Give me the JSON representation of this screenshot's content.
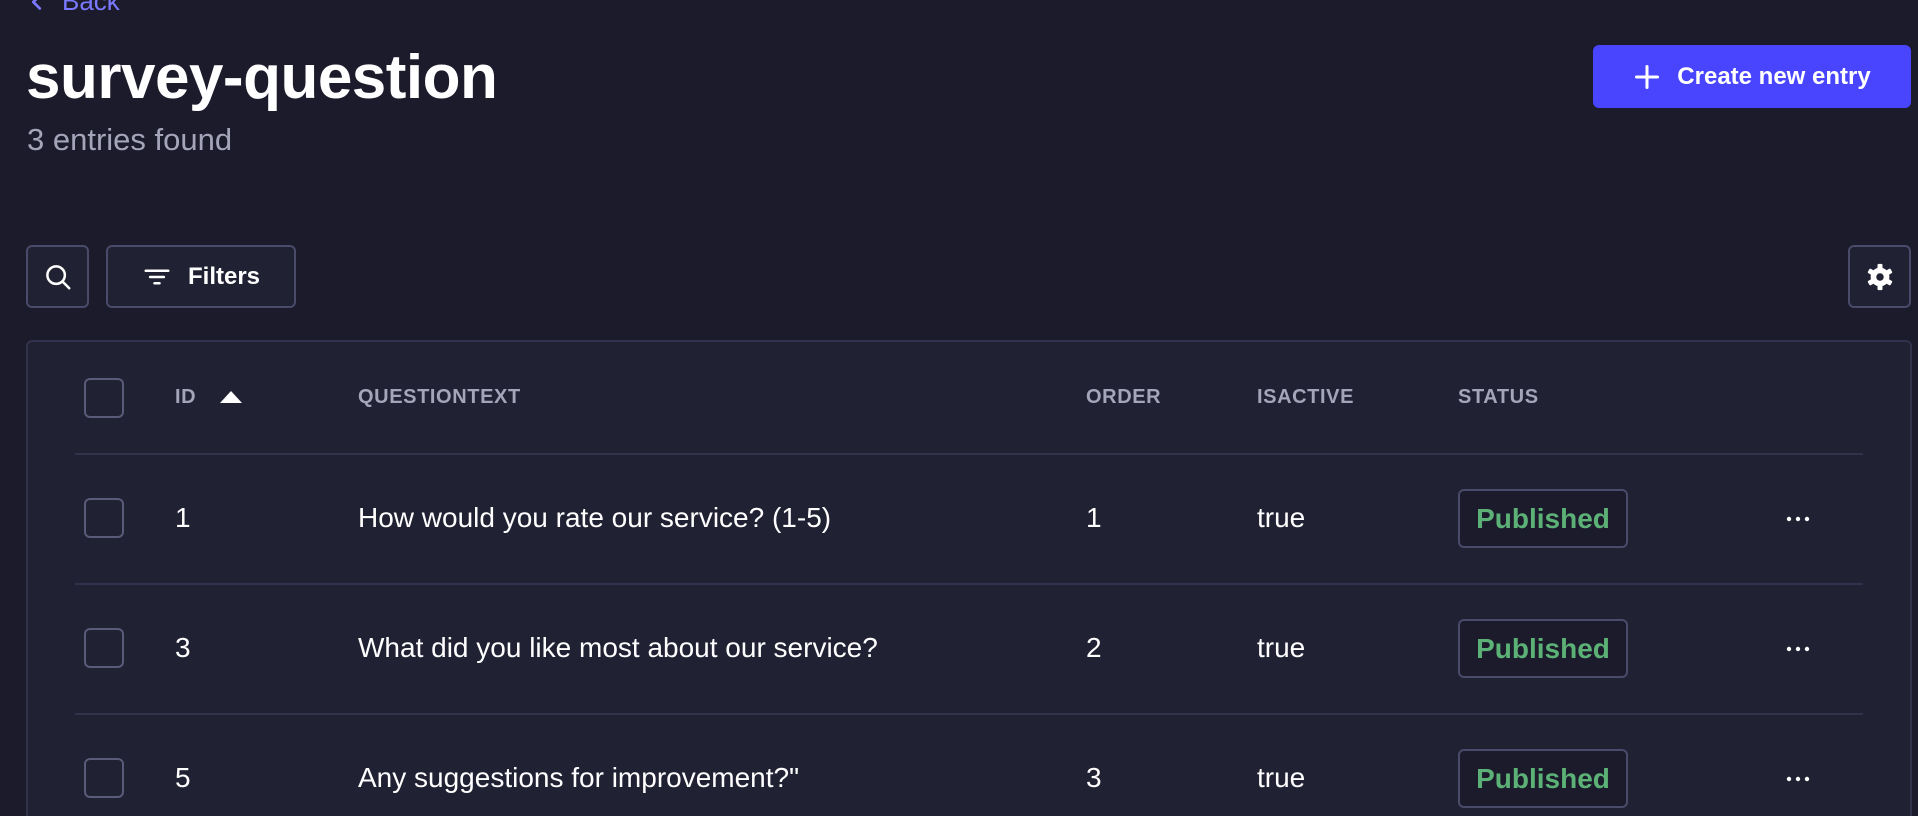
{
  "header": {
    "back_label": "Back",
    "title": "survey-question",
    "subtitle": "3 entries found",
    "create_label": "Create new entry"
  },
  "toolbar": {
    "filters_label": "Filters"
  },
  "table": {
    "columns": [
      "ID",
      "QUESTIONTEXT",
      "ORDER",
      "ISACTIVE",
      "STATUS"
    ],
    "sort": {
      "column": "ID",
      "direction": "ascending"
    },
    "rows": [
      {
        "id": "1",
        "questiontext": "How would you rate our service? (1-5)",
        "order": "1",
        "isactive": "true",
        "status": "Published"
      },
      {
        "id": "3",
        "questiontext": "What did you like most about our service?",
        "order": "2",
        "isactive": "true",
        "status": "Published"
      },
      {
        "id": "5",
        "questiontext": "Any suggestions for improvement?\"",
        "order": "3",
        "isactive": "true",
        "status": "Published"
      }
    ]
  },
  "colors": {
    "background": "#1b1b2b",
    "surface": "#212134",
    "primary": "#4945ff",
    "link": "#7b79ff",
    "published": "#5cb176",
    "muted_text": "#a5a5ba"
  },
  "icons": {
    "back": "chevron-left-icon",
    "create": "plus-icon",
    "search": "search-icon",
    "filters": "filter-icon",
    "settings": "gear-icon",
    "sort": "sort-ascending-icon",
    "row_actions": "more-horizontal-icon"
  }
}
